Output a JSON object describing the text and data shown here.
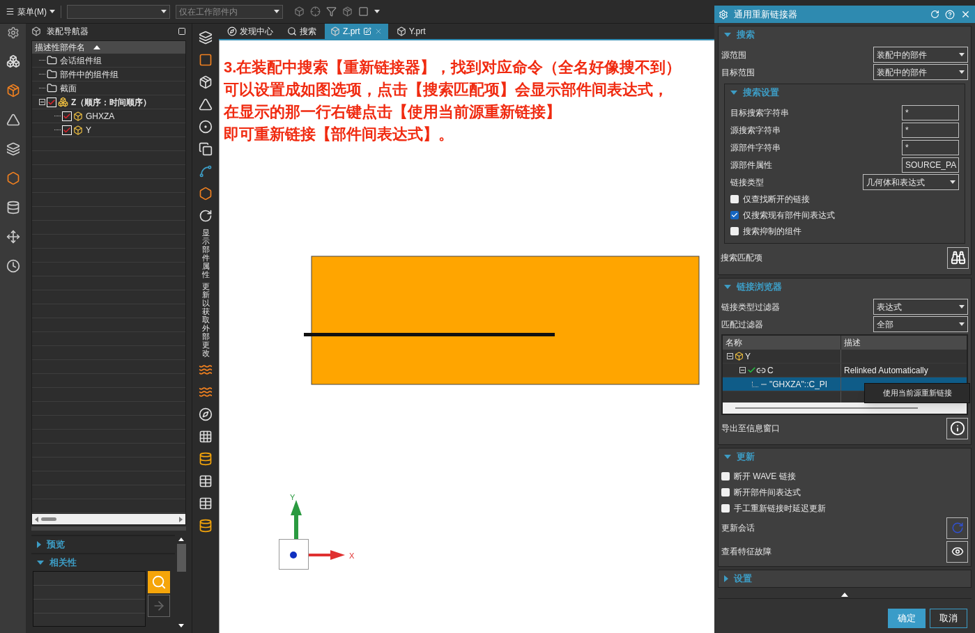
{
  "top_bar": {
    "menu": "菜单(M)",
    "scope": "仅在工作部件内"
  },
  "navigator": {
    "title": "装配导航器",
    "column": "描述性部件名",
    "tree": [
      {
        "label": "会话组件组",
        "kind": "folder"
      },
      {
        "label": "部件中的组件组",
        "kind": "folder"
      },
      {
        "label": "截面",
        "kind": "folder"
      },
      {
        "label": "Z（顺序：时间顺序）",
        "kind": "assembly",
        "checked": true,
        "expanded": true,
        "children": [
          {
            "label": "GHXZA",
            "kind": "part",
            "checked": true
          },
          {
            "label": "Y",
            "kind": "part",
            "checked": true
          }
        ]
      }
    ]
  },
  "lower_sections": [
    {
      "title": "预览",
      "expanded": false
    },
    {
      "title": "相关性",
      "expanded": true
    }
  ],
  "vertical_toolbar_labels": [
    "显示部件属性",
    "更新以获取外部更改"
  ],
  "tabs": [
    {
      "label": "发现中心",
      "kind": "discover",
      "selected": false
    },
    {
      "label": "搜索",
      "kind": "search",
      "selected": false
    },
    {
      "label": "Z.prt",
      "kind": "part",
      "selected": true
    },
    {
      "label": "Y.prt",
      "kind": "part",
      "selected": false
    }
  ],
  "annotation": [
    "3.在装配中搜索【重新链接器】，找到对应命令（全名好像搜不到）",
    "可以设置成如图选项，点击【搜索匹配项】会显示部件间表达式，",
    "在显示的那一行右键点击【使用当前源重新链接】",
    "即可重新链接【部件间表达式】。"
  ],
  "axes": {
    "x": "X",
    "y": "Y"
  },
  "dialog": {
    "title": "通用重新链接器",
    "search": {
      "title": "搜索",
      "expanded": true,
      "fields": [
        {
          "label": "源范围",
          "kind": "select",
          "value": "装配中的部件"
        },
        {
          "label": "目标范围",
          "kind": "select",
          "value": "装配中的部件"
        }
      ],
      "settings": {
        "title": "搜索设置",
        "expanded": true,
        "fields": [
          {
            "label": "目标搜索字符串",
            "kind": "text",
            "value": "*"
          },
          {
            "label": "源搜索字符串",
            "kind": "text",
            "value": "*"
          },
          {
            "label": "源部件字符串",
            "kind": "text",
            "value": "*"
          },
          {
            "label": "源部件属性",
            "kind": "text",
            "value": "SOURCE_PA"
          },
          {
            "label": "链接类型",
            "kind": "select",
            "value": "几何体和表达式"
          }
        ],
        "options": [
          {
            "label": "仅查找断开的链接",
            "checked": false
          },
          {
            "label": "仅搜索现有部件间表达式",
            "checked": true
          },
          {
            "label": "搜索抑制的组件",
            "checked": false
          }
        ]
      },
      "action": "搜索匹配项"
    },
    "browser": {
      "title": "链接浏览器",
      "expanded": true,
      "fields": [
        {
          "label": "链接类型过滤器",
          "kind": "select",
          "value": "表达式"
        },
        {
          "label": "匹配过滤器",
          "kind": "select",
          "value": "全部"
        }
      ],
      "columns": [
        "名称",
        "描述"
      ],
      "rows": [
        {
          "name": "Y",
          "kind": "part",
          "selected": false,
          "expanded": true,
          "children": [
            {
              "name": "C",
              "kind": "link",
              "selected": false,
              "expanded": true,
              "description": "Relinked Automatically",
              "children": [
                {
                  "name": "\"GHXZA\"::C_PI",
                  "kind": "expression",
                  "selected": true
                }
              ]
            }
          ]
        }
      ],
      "context_menu": [
        "使用当前源重新链接"
      ],
      "export": "导出至信息窗口"
    },
    "update": {
      "title": "更新",
      "expanded": true,
      "options": [
        {
          "label": "断开 WAVE 链接",
          "checked": false
        },
        {
          "label": "断开部件间表达式",
          "checked": false
        },
        {
          "label": "手工重新链接时延迟更新",
          "checked": false
        }
      ],
      "actions": [
        {
          "label": "更新会话",
          "kind": "update"
        },
        {
          "label": "查看特征故障",
          "kind": "inspect"
        }
      ]
    },
    "settings": {
      "title": "设置",
      "expanded": false
    },
    "buttons": [
      {
        "label": "确定",
        "kind": "primary"
      },
      {
        "label": "取消",
        "kind": "secondary"
      }
    ]
  }
}
